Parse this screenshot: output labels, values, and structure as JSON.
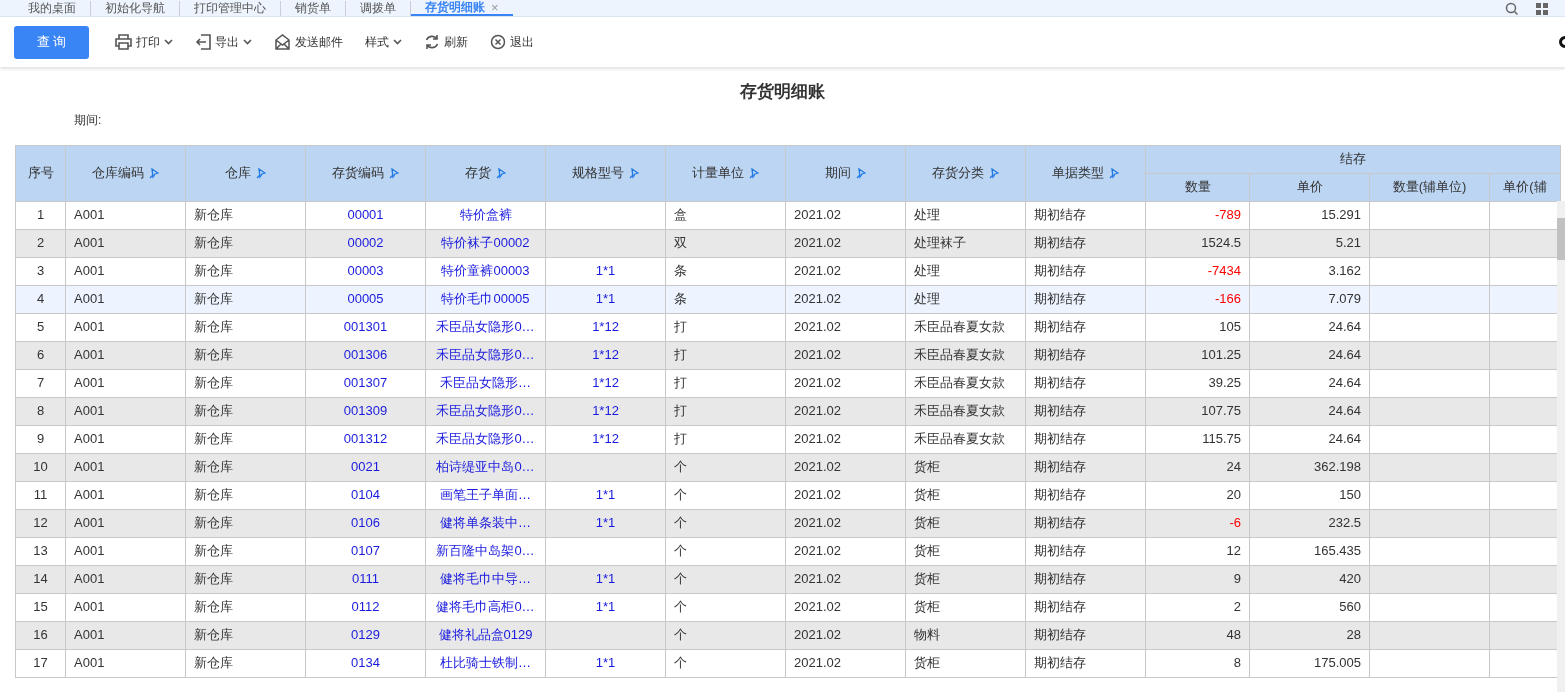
{
  "tabs": [
    {
      "label": "我的桌面",
      "selected": false,
      "closable": false
    },
    {
      "label": "初始化导航",
      "selected": false,
      "closable": false
    },
    {
      "label": "打印管理中心",
      "selected": false,
      "closable": false
    },
    {
      "label": "销货单",
      "selected": false,
      "closable": false
    },
    {
      "label": "调拨单",
      "selected": false,
      "closable": false
    },
    {
      "label": "存货明细账",
      "selected": true,
      "closable": true,
      "close": "×"
    }
  ],
  "toolbar": {
    "query_button": "查 询",
    "items": [
      {
        "kind": "print",
        "label": "打印",
        "dropdown": true
      },
      {
        "kind": "export",
        "label": "导出",
        "dropdown": true
      },
      {
        "kind": "mail",
        "label": "发送邮件",
        "dropdown": false
      },
      {
        "kind": "style",
        "label": "样式",
        "dropdown": true
      },
      {
        "kind": "refresh",
        "label": "刷新",
        "dropdown": false
      },
      {
        "kind": "exit",
        "label": "退出",
        "dropdown": false
      }
    ]
  },
  "report": {
    "title": "存货明细账",
    "period_label": "期间:"
  },
  "table": {
    "columns": [
      {
        "label": "序号",
        "sortable": false
      },
      {
        "label": "仓库编码",
        "sortable": true
      },
      {
        "label": "仓库",
        "sortable": true
      },
      {
        "label": "存货编码",
        "sortable": true
      },
      {
        "label": "存货",
        "sortable": true
      },
      {
        "label": "规格型号",
        "sortable": true
      },
      {
        "label": "计量单位",
        "sortable": true
      },
      {
        "label": "期间",
        "sortable": true
      },
      {
        "label": "存货分类",
        "sortable": true
      },
      {
        "label": "单据类型",
        "sortable": true
      }
    ],
    "group": {
      "label": "结存",
      "columns": [
        "数量",
        "单价",
        "数量(辅单位)",
        "单价(辅"
      ]
    },
    "rows": [
      {
        "seq": "1",
        "wh_code": "A001",
        "wh": "新仓库",
        "code": "00001",
        "name": "特价盒裤",
        "spec": "",
        "unit": "盒",
        "period": "2021.02",
        "category": "处理",
        "doc_type": "期初结存",
        "qty": "-789",
        "price": "15.291",
        "negative": true,
        "selected": false
      },
      {
        "seq": "2",
        "wh_code": "A001",
        "wh": "新仓库",
        "code": "00002",
        "name": "特价袜子00002",
        "spec": "",
        "unit": "双",
        "period": "2021.02",
        "category": "处理袜子",
        "doc_type": "期初结存",
        "qty": "1524.5",
        "price": "5.21",
        "negative": false,
        "selected": false
      },
      {
        "seq": "3",
        "wh_code": "A001",
        "wh": "新仓库",
        "code": "00003",
        "name": "特价童裤00003",
        "spec": "1*1",
        "unit": "条",
        "period": "2021.02",
        "category": "处理",
        "doc_type": "期初结存",
        "qty": "-7434",
        "price": "3.162",
        "negative": true,
        "selected": false
      },
      {
        "seq": "4",
        "wh_code": "A001",
        "wh": "新仓库",
        "code": "00005",
        "name": "特价毛巾00005",
        "spec": "1*1",
        "unit": "条",
        "period": "2021.02",
        "category": "处理",
        "doc_type": "期初结存",
        "qty": "-166",
        "price": "7.079",
        "negative": true,
        "selected": true
      },
      {
        "seq": "5",
        "wh_code": "A001",
        "wh": "新仓库",
        "code": "001301",
        "name": "禾臣品女隐形0…",
        "spec": "1*12",
        "unit": "打",
        "period": "2021.02",
        "category": "禾臣品春夏女款",
        "doc_type": "期初结存",
        "qty": "105",
        "price": "24.64",
        "negative": false,
        "selected": false
      },
      {
        "seq": "6",
        "wh_code": "A001",
        "wh": "新仓库",
        "code": "001306",
        "name": "禾臣品女隐形0…",
        "spec": "1*12",
        "unit": "打",
        "period": "2021.02",
        "category": "禾臣品春夏女款",
        "doc_type": "期初结存",
        "qty": "101.25",
        "price": "24.64",
        "negative": false,
        "selected": false
      },
      {
        "seq": "7",
        "wh_code": "A001",
        "wh": "新仓库",
        "code": "001307",
        "name": "禾臣品女隐形…",
        "spec": "1*12",
        "unit": "打",
        "period": "2021.02",
        "category": "禾臣品春夏女款",
        "doc_type": "期初结存",
        "qty": "39.25",
        "price": "24.64",
        "negative": false,
        "selected": false
      },
      {
        "seq": "8",
        "wh_code": "A001",
        "wh": "新仓库",
        "code": "001309",
        "name": "禾臣品女隐形0…",
        "spec": "1*12",
        "unit": "打",
        "period": "2021.02",
        "category": "禾臣品春夏女款",
        "doc_type": "期初结存",
        "qty": "107.75",
        "price": "24.64",
        "negative": false,
        "selected": false
      },
      {
        "seq": "9",
        "wh_code": "A001",
        "wh": "新仓库",
        "code": "001312",
        "name": "禾臣品女隐形0…",
        "spec": "1*12",
        "unit": "打",
        "period": "2021.02",
        "category": "禾臣品春夏女款",
        "doc_type": "期初结存",
        "qty": "115.75",
        "price": "24.64",
        "negative": false,
        "selected": false
      },
      {
        "seq": "10",
        "wh_code": "A001",
        "wh": "新仓库",
        "code": "0021",
        "name": "柏诗缇亚中岛0…",
        "spec": "",
        "unit": "个",
        "period": "2021.02",
        "category": "货柜",
        "doc_type": "期初结存",
        "qty": "24",
        "price": "362.198",
        "negative": false,
        "selected": false
      },
      {
        "seq": "11",
        "wh_code": "A001",
        "wh": "新仓库",
        "code": "0104",
        "name": "画笔王子单面…",
        "spec": "1*1",
        "unit": "个",
        "period": "2021.02",
        "category": "货柜",
        "doc_type": "期初结存",
        "qty": "20",
        "price": "150",
        "negative": false,
        "selected": false
      },
      {
        "seq": "12",
        "wh_code": "A001",
        "wh": "新仓库",
        "code": "0106",
        "name": "健将单条装中…",
        "spec": "1*1",
        "unit": "个",
        "period": "2021.02",
        "category": "货柜",
        "doc_type": "期初结存",
        "qty": "-6",
        "price": "232.5",
        "negative": true,
        "selected": false
      },
      {
        "seq": "13",
        "wh_code": "A001",
        "wh": "新仓库",
        "code": "0107",
        "name": "新百隆中岛架0…",
        "spec": "",
        "unit": "个",
        "period": "2021.02",
        "category": "货柜",
        "doc_type": "期初结存",
        "qty": "12",
        "price": "165.435",
        "negative": false,
        "selected": false
      },
      {
        "seq": "14",
        "wh_code": "A001",
        "wh": "新仓库",
        "code": "0111",
        "name": "健将毛巾中导…",
        "spec": "1*1",
        "unit": "个",
        "period": "2021.02",
        "category": "货柜",
        "doc_type": "期初结存",
        "qty": "9",
        "price": "420",
        "negative": false,
        "selected": false
      },
      {
        "seq": "15",
        "wh_code": "A001",
        "wh": "新仓库",
        "code": "0112",
        "name": "健将毛巾高柜0…",
        "spec": "1*1",
        "unit": "个",
        "period": "2021.02",
        "category": "货柜",
        "doc_type": "期初结存",
        "qty": "2",
        "price": "560",
        "negative": false,
        "selected": false
      },
      {
        "seq": "16",
        "wh_code": "A001",
        "wh": "新仓库",
        "code": "0129",
        "name": "健将礼品盒0129",
        "spec": "",
        "unit": "个",
        "period": "2021.02",
        "category": "物料",
        "doc_type": "期初结存",
        "qty": "48",
        "price": "28",
        "negative": false,
        "selected": false
      },
      {
        "seq": "17",
        "wh_code": "A001",
        "wh": "新仓库",
        "code": "0134",
        "name": "杜比骑士铁制…",
        "spec": "1*1",
        "unit": "个",
        "period": "2021.02",
        "category": "货柜",
        "doc_type": "期初结存",
        "qty": "8",
        "price": "175.005",
        "negative": false,
        "selected": false
      }
    ]
  }
}
